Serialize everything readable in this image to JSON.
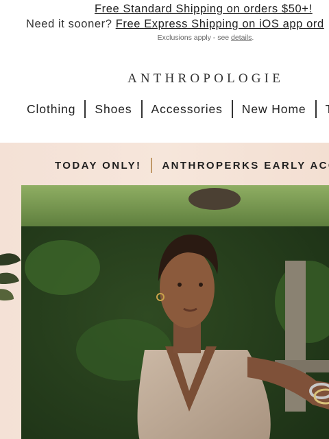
{
  "promo": {
    "line1_link": "Free Standard Shipping on orders $50+!",
    "line2_prefix": "Need it sooner? ",
    "line2_link": "Free Express Shipping on iOS app ord",
    "exclusions_prefix": "Exclusions apply - see ",
    "exclusions_link": "details",
    "exclusions_suffix": "."
  },
  "logo": {
    "text": "ANTHROPOLOGIE"
  },
  "nav": {
    "items": [
      "Clothing",
      "Shoes",
      "Accessories",
      "New Home",
      "T"
    ]
  },
  "hero": {
    "banner_left": "TODAY ONLY!",
    "banner_right": "ANTHROPERKS EARLY ACC",
    "banner_divider_color": "#c19968",
    "background_color": "#f4e1d6"
  }
}
